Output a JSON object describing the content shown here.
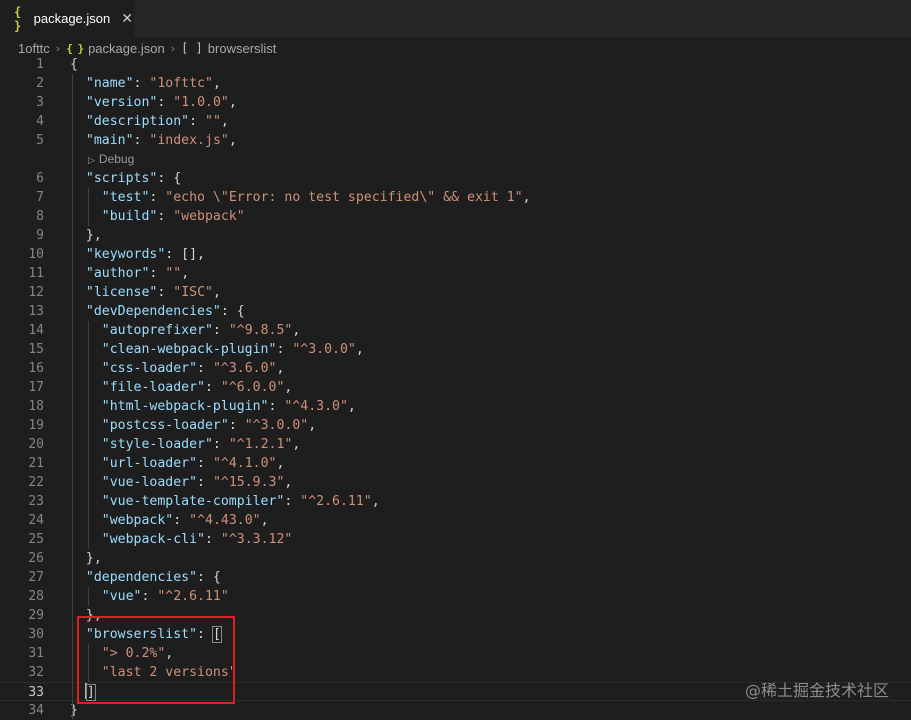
{
  "tab": {
    "icon": "json-braces-icon",
    "label": "package.json",
    "close_glyph": "✕"
  },
  "breadcrumb": {
    "folder": "1ofttc",
    "file": "package.json",
    "symbol": "browserslist",
    "separator": "›"
  },
  "codelens": {
    "label": "Debug",
    "icon": "play-icon"
  },
  "watermark": "@稀土掘金技术社区",
  "colors": {
    "key": "#9cdcfe",
    "string": "#ce9178",
    "punctuation": "#d4d4d4",
    "highlight_border": "#e02020"
  },
  "code": [
    {
      "num": "1",
      "tokens": [
        [
          "p",
          "{"
        ]
      ]
    },
    {
      "num": "2",
      "tokens": [
        [
          "p",
          "  "
        ],
        [
          "k",
          "\"name\""
        ],
        [
          "p",
          ": "
        ],
        [
          "s",
          "\"1ofttc\""
        ],
        [
          "p",
          ","
        ]
      ]
    },
    {
      "num": "3",
      "tokens": [
        [
          "p",
          "  "
        ],
        [
          "k",
          "\"version\""
        ],
        [
          "p",
          ": "
        ],
        [
          "s",
          "\"1.0.0\""
        ],
        [
          "p",
          ","
        ]
      ]
    },
    {
      "num": "4",
      "tokens": [
        [
          "p",
          "  "
        ],
        [
          "k",
          "\"description\""
        ],
        [
          "p",
          ": "
        ],
        [
          "s",
          "\"\""
        ],
        [
          "p",
          ","
        ]
      ]
    },
    {
      "num": "5",
      "tokens": [
        [
          "p",
          "  "
        ],
        [
          "k",
          "\"main\""
        ],
        [
          "p",
          ": "
        ],
        [
          "s",
          "\"index.js\""
        ],
        [
          "p",
          ","
        ]
      ]
    },
    {
      "num": "6",
      "tokens": [
        [
          "p",
          "  "
        ],
        [
          "k",
          "\"scripts\""
        ],
        [
          "p",
          ": {"
        ]
      ]
    },
    {
      "num": "7",
      "tokens": [
        [
          "p",
          "    "
        ],
        [
          "k",
          "\"test\""
        ],
        [
          "p",
          ": "
        ],
        [
          "s",
          "\"echo \\\"Error: no test specified\\\" && exit 1\""
        ],
        [
          "p",
          ","
        ]
      ]
    },
    {
      "num": "8",
      "tokens": [
        [
          "p",
          "    "
        ],
        [
          "k",
          "\"build\""
        ],
        [
          "p",
          ": "
        ],
        [
          "s",
          "\"webpack\""
        ]
      ]
    },
    {
      "num": "9",
      "tokens": [
        [
          "p",
          "  },"
        ]
      ]
    },
    {
      "num": "10",
      "tokens": [
        [
          "p",
          "  "
        ],
        [
          "k",
          "\"keywords\""
        ],
        [
          "p",
          ": [],"
        ]
      ]
    },
    {
      "num": "11",
      "tokens": [
        [
          "p",
          "  "
        ],
        [
          "k",
          "\"author\""
        ],
        [
          "p",
          ": "
        ],
        [
          "s",
          "\"\""
        ],
        [
          "p",
          ","
        ]
      ]
    },
    {
      "num": "12",
      "tokens": [
        [
          "p",
          "  "
        ],
        [
          "k",
          "\"license\""
        ],
        [
          "p",
          ": "
        ],
        [
          "s",
          "\"ISC\""
        ],
        [
          "p",
          ","
        ]
      ]
    },
    {
      "num": "13",
      "tokens": [
        [
          "p",
          "  "
        ],
        [
          "k",
          "\"devDependencies\""
        ],
        [
          "p",
          ": {"
        ]
      ]
    },
    {
      "num": "14",
      "tokens": [
        [
          "p",
          "    "
        ],
        [
          "k",
          "\"autoprefixer\""
        ],
        [
          "p",
          ": "
        ],
        [
          "s",
          "\"^9.8.5\""
        ],
        [
          "p",
          ","
        ]
      ]
    },
    {
      "num": "15",
      "tokens": [
        [
          "p",
          "    "
        ],
        [
          "k",
          "\"clean-webpack-plugin\""
        ],
        [
          "p",
          ": "
        ],
        [
          "s",
          "\"^3.0.0\""
        ],
        [
          "p",
          ","
        ]
      ]
    },
    {
      "num": "16",
      "tokens": [
        [
          "p",
          "    "
        ],
        [
          "k",
          "\"css-loader\""
        ],
        [
          "p",
          ": "
        ],
        [
          "s",
          "\"^3.6.0\""
        ],
        [
          "p",
          ","
        ]
      ]
    },
    {
      "num": "17",
      "tokens": [
        [
          "p",
          "    "
        ],
        [
          "k",
          "\"file-loader\""
        ],
        [
          "p",
          ": "
        ],
        [
          "s",
          "\"^6.0.0\""
        ],
        [
          "p",
          ","
        ]
      ]
    },
    {
      "num": "18",
      "tokens": [
        [
          "p",
          "    "
        ],
        [
          "k",
          "\"html-webpack-plugin\""
        ],
        [
          "p",
          ": "
        ],
        [
          "s",
          "\"^4.3.0\""
        ],
        [
          "p",
          ","
        ]
      ]
    },
    {
      "num": "19",
      "tokens": [
        [
          "p",
          "    "
        ],
        [
          "k",
          "\"postcss-loader\""
        ],
        [
          "p",
          ": "
        ],
        [
          "s",
          "\"^3.0.0\""
        ],
        [
          "p",
          ","
        ]
      ]
    },
    {
      "num": "20",
      "tokens": [
        [
          "p",
          "    "
        ],
        [
          "k",
          "\"style-loader\""
        ],
        [
          "p",
          ": "
        ],
        [
          "s",
          "\"^1.2.1\""
        ],
        [
          "p",
          ","
        ]
      ]
    },
    {
      "num": "21",
      "tokens": [
        [
          "p",
          "    "
        ],
        [
          "k",
          "\"url-loader\""
        ],
        [
          "p",
          ": "
        ],
        [
          "s",
          "\"^4.1.0\""
        ],
        [
          "p",
          ","
        ]
      ]
    },
    {
      "num": "22",
      "tokens": [
        [
          "p",
          "    "
        ],
        [
          "k",
          "\"vue-loader\""
        ],
        [
          "p",
          ": "
        ],
        [
          "s",
          "\"^15.9.3\""
        ],
        [
          "p",
          ","
        ]
      ]
    },
    {
      "num": "23",
      "tokens": [
        [
          "p",
          "    "
        ],
        [
          "k",
          "\"vue-template-compiler\""
        ],
        [
          "p",
          ": "
        ],
        [
          "s",
          "\"^2.6.11\""
        ],
        [
          "p",
          ","
        ]
      ]
    },
    {
      "num": "24",
      "tokens": [
        [
          "p",
          "    "
        ],
        [
          "k",
          "\"webpack\""
        ],
        [
          "p",
          ": "
        ],
        [
          "s",
          "\"^4.43.0\""
        ],
        [
          "p",
          ","
        ]
      ]
    },
    {
      "num": "25",
      "tokens": [
        [
          "p",
          "    "
        ],
        [
          "k",
          "\"webpack-cli\""
        ],
        [
          "p",
          ": "
        ],
        [
          "s",
          "\"^3.3.12\""
        ]
      ]
    },
    {
      "num": "26",
      "tokens": [
        [
          "p",
          "  },"
        ]
      ]
    },
    {
      "num": "27",
      "tokens": [
        [
          "p",
          "  "
        ],
        [
          "k",
          "\"dependencies\""
        ],
        [
          "p",
          ": {"
        ]
      ]
    },
    {
      "num": "28",
      "tokens": [
        [
          "p",
          "    "
        ],
        [
          "k",
          "\"vue\""
        ],
        [
          "p",
          ": "
        ],
        [
          "s",
          "\"^2.6.11\""
        ]
      ]
    },
    {
      "num": "29",
      "tokens": [
        [
          "p",
          "  },"
        ]
      ]
    },
    {
      "num": "30",
      "tokens": [
        [
          "p",
          "  "
        ],
        [
          "k",
          "\"browserslist\""
        ],
        [
          "p",
          ": "
        ],
        [
          "b",
          "["
        ]
      ]
    },
    {
      "num": "31",
      "tokens": [
        [
          "p",
          "    "
        ],
        [
          "s",
          "\"> 0.2%\""
        ],
        [
          "p",
          ","
        ]
      ]
    },
    {
      "num": "32",
      "tokens": [
        [
          "p",
          "    "
        ],
        [
          "s",
          "\"last 2 versions\""
        ]
      ]
    },
    {
      "num": "33",
      "tokens": [
        [
          "p",
          "  "
        ],
        [
          "c",
          ""
        ],
        [
          "b",
          "]"
        ]
      ],
      "current": true
    },
    {
      "num": "34",
      "tokens": [
        [
          "p",
          "}"
        ]
      ]
    }
  ]
}
